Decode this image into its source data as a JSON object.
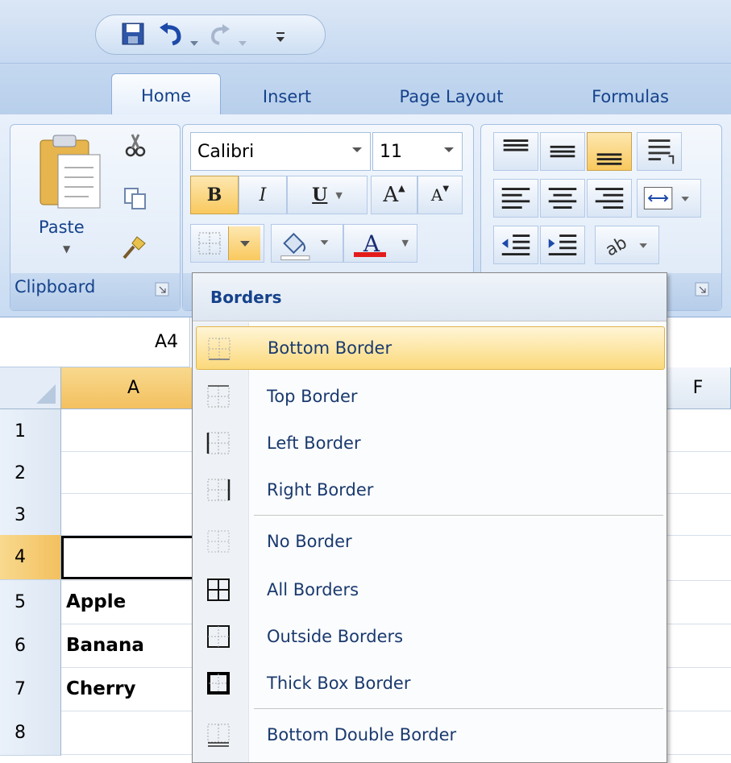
{
  "qat": {
    "icons": [
      "save-icon",
      "undo-icon",
      "redo-icon",
      "customize-qat-icon"
    ]
  },
  "tabs": [
    {
      "label": "Home",
      "active": true
    },
    {
      "label": "Insert"
    },
    {
      "label": "Page Layout"
    },
    {
      "label": "Formulas"
    }
  ],
  "clipboard": {
    "paste_label": "Paste",
    "group_label": "Clipboard"
  },
  "font": {
    "name": "Calibri",
    "size": "11",
    "bold": "B",
    "italic": "I",
    "underline": "U",
    "grow": "A",
    "shrink": "A",
    "font_color_letter": "A",
    "font_color": "#e31b1b",
    "fill_color": "#ffffff"
  },
  "namebox": "A4",
  "columns": [
    "A",
    "F"
  ],
  "rows": [
    "1",
    "2",
    "3",
    "4",
    "5",
    "6",
    "7",
    "8"
  ],
  "cells": {
    "A5": "Apple",
    "A6": "Banana",
    "A7": "Cherry"
  },
  "menu": {
    "title": "Borders",
    "items": [
      {
        "label": "Bottom Border",
        "icon": "bottom-border-icon",
        "highlighted": true
      },
      {
        "label": "Top Border",
        "icon": "top-border-icon"
      },
      {
        "label": "Left Border",
        "icon": "left-border-icon"
      },
      {
        "label": "Right Border",
        "icon": "right-border-icon"
      },
      {
        "label": "No Border",
        "icon": "no-border-icon"
      },
      {
        "label": "All Borders",
        "icon": "all-borders-icon"
      },
      {
        "label": "Outside Borders",
        "icon": "outside-borders-icon"
      },
      {
        "label": "Thick Box Border",
        "icon": "thick-box-border-icon"
      },
      {
        "label": "Bottom Double Border",
        "icon": "bottom-double-border-icon"
      }
    ]
  },
  "colors": {
    "accent_highlight": "#f9c95e",
    "ribbon_text": "#15428b"
  }
}
